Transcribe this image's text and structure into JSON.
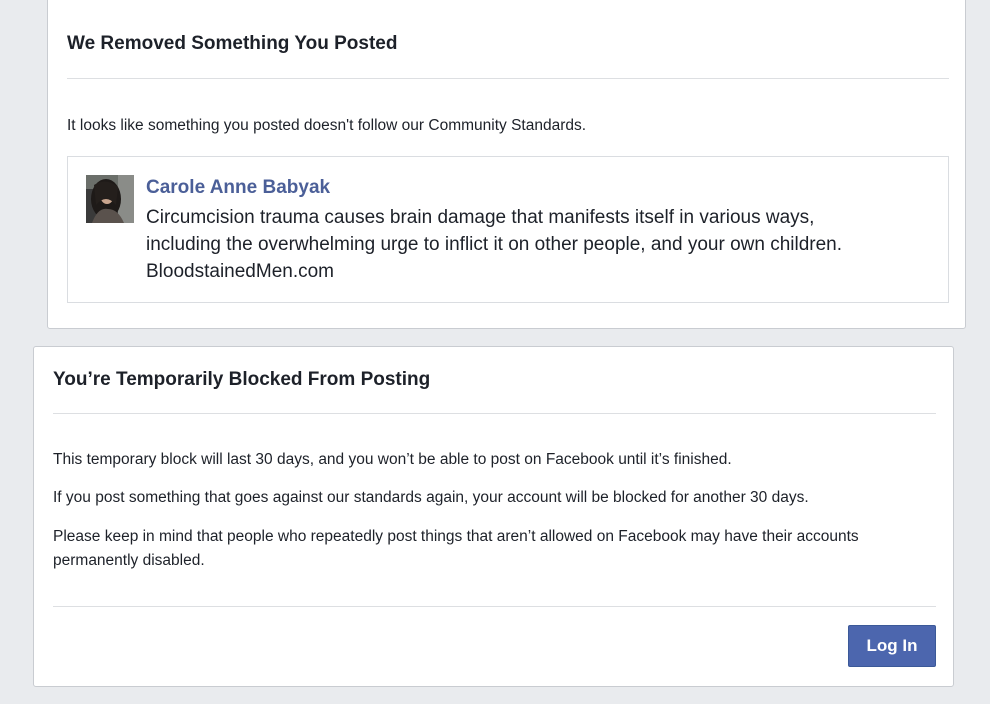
{
  "removed_card": {
    "title": "We Removed Something You Posted",
    "intro": "It looks like something you posted doesn't follow our Community Standards.",
    "post": {
      "author": "Carole Anne Babyak",
      "text": "Circumcision trauma causes brain damage that manifests itself in various ways,\nincluding the overwhelming urge to inflict it on other people, and your own children.\nBloodstainedMen.com"
    }
  },
  "blocked_card": {
    "title": "You’re Temporarily Blocked From Posting",
    "paragraphs": [
      "This temporary block will last 30 days, and you won’t be able to post on Facebook until it’s finished.",
      "If you post something that goes against our standards again, your account will be blocked for another 30 days.",
      "Please keep in mind that people who repeatedly post things that aren’t allowed on Facebook may have their accounts permanently disabled."
    ],
    "login_label": "Log In"
  },
  "colors": {
    "page_background": "#e9ebee",
    "author_link": "#4b5f98",
    "button_blue": "#4c66ae",
    "text": "#1d2129",
    "divider": "#dddfe2"
  }
}
